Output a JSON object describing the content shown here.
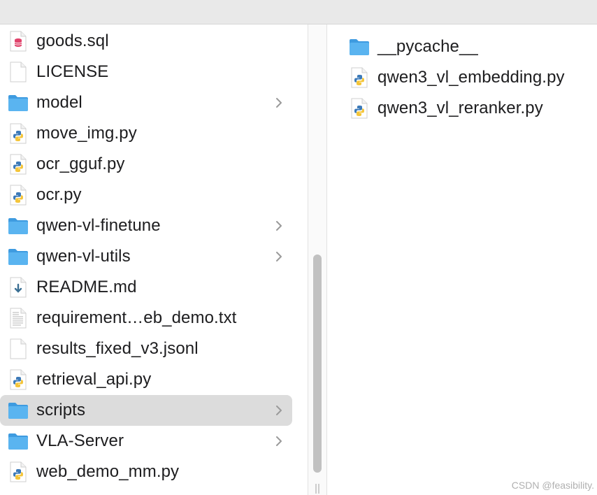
{
  "colors": {
    "folder": "#5ab4f0",
    "python_blue": "#3d7ab8",
    "python_yellow": "#f4c53a",
    "sql_red": "#e0436b",
    "selection": "#dcdcdc",
    "readme_arrow": "#3a6f93"
  },
  "left_column": {
    "items": [
      {
        "name": "goods.sql",
        "icon": "sql-file-icon"
      },
      {
        "name": "LICENSE",
        "icon": "blank-file-icon"
      },
      {
        "name": "model",
        "icon": "folder-icon",
        "has_children": true
      },
      {
        "name": "move_img.py",
        "icon": "python-file-icon"
      },
      {
        "name": "ocr_gguf.py",
        "icon": "python-file-icon"
      },
      {
        "name": "ocr.py",
        "icon": "python-file-icon"
      },
      {
        "name": "qwen-vl-finetune",
        "icon": "folder-icon",
        "has_children": true
      },
      {
        "name": "qwen-vl-utils",
        "icon": "folder-icon",
        "has_children": true
      },
      {
        "name": "README.md",
        "icon": "markdown-file-icon"
      },
      {
        "name": "requirement…eb_demo.txt",
        "icon": "text-file-icon"
      },
      {
        "name": "results_fixed_v3.jsonl",
        "icon": "blank-file-icon"
      },
      {
        "name": "retrieval_api.py",
        "icon": "python-file-icon"
      },
      {
        "name": "scripts",
        "icon": "folder-icon",
        "has_children": true,
        "selected": true
      },
      {
        "name": "VLA-Server",
        "icon": "folder-icon",
        "has_children": true
      },
      {
        "name": "web_demo_mm.py",
        "icon": "python-file-icon"
      }
    ]
  },
  "right_column": {
    "items": [
      {
        "name": "__pycache__",
        "icon": "folder-icon"
      },
      {
        "name": "qwen3_vl_embedding.py",
        "icon": "python-file-icon"
      },
      {
        "name": "qwen3_vl_reranker.py",
        "icon": "python-file-icon"
      }
    ]
  },
  "watermark": "CSDN @feasibility."
}
